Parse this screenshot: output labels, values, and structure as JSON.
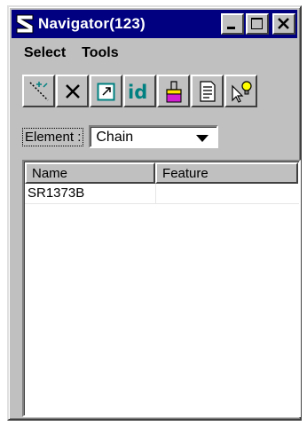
{
  "window": {
    "title": "Navigator(123)",
    "buttons": [
      "minimize",
      "maximize",
      "close"
    ]
  },
  "menubar": {
    "items": [
      {
        "label": "Select"
      },
      {
        "label": "Tools"
      }
    ]
  },
  "toolbar": {
    "tools": [
      {
        "icon": "magic-wand-icon"
      },
      {
        "icon": "x-delete-icon"
      },
      {
        "icon": "open-window-icon"
      },
      {
        "icon": "id-icon"
      },
      {
        "icon": "paint-bucket-icon"
      },
      {
        "icon": "document-icon"
      },
      {
        "icon": "pointer-bulb-icon"
      }
    ]
  },
  "element_filter": {
    "label": "Element :",
    "value": "Chain"
  },
  "list": {
    "columns": [
      "Name",
      "Feature"
    ],
    "rows": [
      {
        "name": "SR1373B",
        "feature": ""
      }
    ]
  },
  "colors": {
    "titlebar": "#000080",
    "face": "#c0c0c0",
    "text": "#000000"
  }
}
